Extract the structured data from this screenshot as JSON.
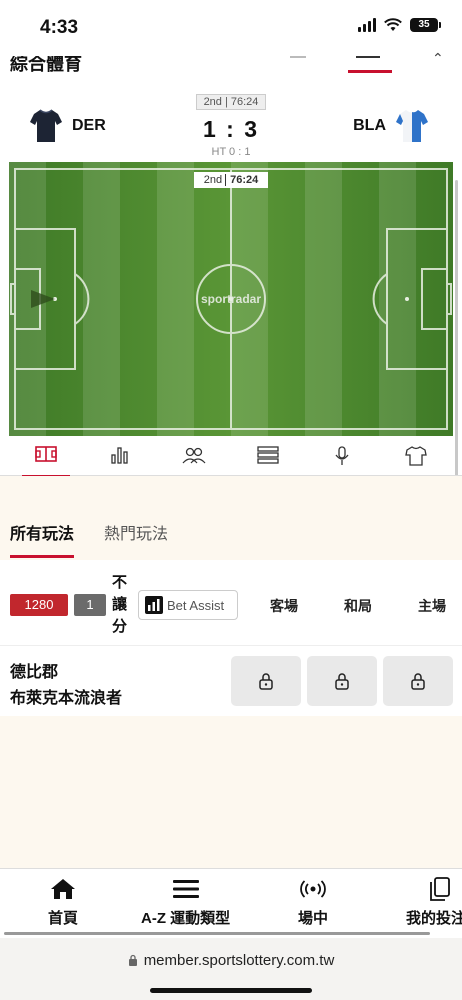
{
  "status": {
    "time": "4:33",
    "battery": "35"
  },
  "header": {
    "title": "綜合體育"
  },
  "match": {
    "period_tag": "2nd | 76:24",
    "home_team": "DER",
    "away_team": "BLA",
    "score": "1 : 3",
    "halftime": "HT 0 : 1",
    "clock_period": "2nd",
    "clock_time": "76:24",
    "provider_brand": "sportradar"
  },
  "tracker_tabs": [
    {
      "icon": "pitch-icon",
      "active": true
    },
    {
      "icon": "stats-bars-icon",
      "active": false
    },
    {
      "icon": "lineup-people-icon",
      "active": false
    },
    {
      "icon": "list-table-icon",
      "active": false
    },
    {
      "icon": "microphone-icon",
      "active": false
    },
    {
      "icon": "jersey-icon",
      "active": false
    }
  ],
  "bet_tabs": {
    "all": "所有玩法",
    "hot": "熱門玩法"
  },
  "market": {
    "badge_count": "1280",
    "badge_num": "1",
    "type_label": "不讓分",
    "bet_assist": "Bet Assist",
    "col_away": "客場",
    "col_draw": "和局",
    "col_home": "主場"
  },
  "row": {
    "home": "德比郡",
    "away": "布萊克本流浪者"
  },
  "bottom_nav": {
    "home": "首頁",
    "az": "A-Z 運動類型",
    "live": "場中",
    "mybets": "我的投注"
  },
  "browser": {
    "url": "member.sportslottery.com.tw"
  },
  "colors": {
    "accent": "#c8102e",
    "pitch": "#4e8a2e"
  }
}
